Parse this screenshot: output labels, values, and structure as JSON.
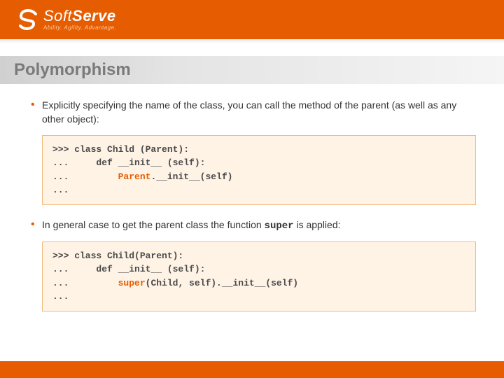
{
  "brand": {
    "name_light": "Soft",
    "name_bold": "Serve",
    "tagline": "Ability. Agility. Advantage."
  },
  "title": "Polymorphism",
  "bullets": [
    "Explicitly specifying the name of the class, you can call the method of the parent (as well as any other object):",
    "In general case to get the parent class the function "
  ],
  "bullet2_mono": "super",
  "bullet2_tail": " is applied:",
  "code1": {
    "l1": ">>> class Child (Parent):",
    "l2": "...     def __init__ (self):",
    "l3a": "...         ",
    "l3b": "Parent",
    "l3c": ".__init__(self)",
    "l4": "..."
  },
  "code2": {
    "l1": ">>> class Child(Parent):",
    "l2": "...     def __init__ (self):",
    "l3a": "...         ",
    "l3b": "super",
    "l3c": "(Child, self).__init__(self)",
    "l4": "..."
  }
}
